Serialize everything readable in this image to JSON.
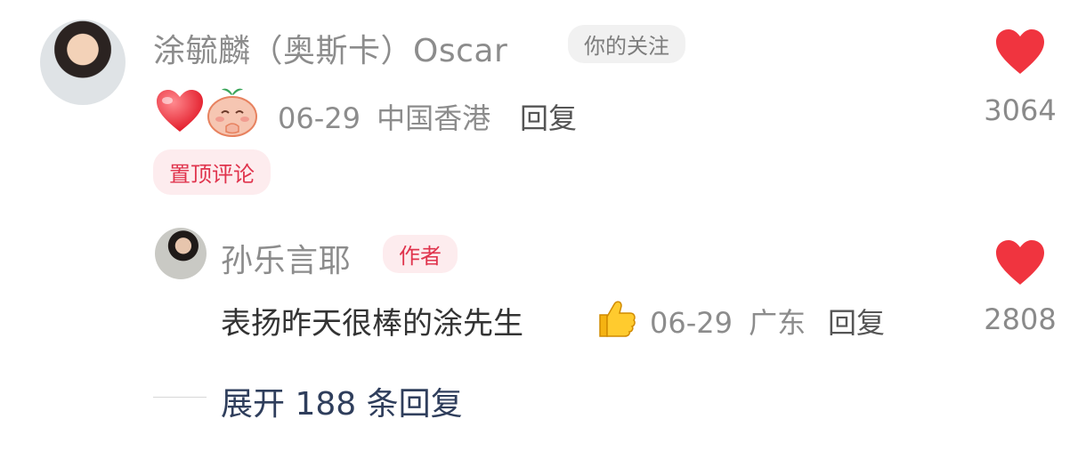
{
  "comment": {
    "username": "涂毓麟（奥斯卡）Oscar",
    "follow_tag": "你的关注",
    "emoji_1": "heart-emoji",
    "emoji_2": "peach-emoji",
    "date": "06-29",
    "location": "中国香港",
    "reply_label": "回复",
    "pinned_label": "置顶评论",
    "like_count": "3064",
    "like_color": "#f0343f"
  },
  "reply": {
    "username": "孙乐言耶",
    "author_tag": "作者",
    "text": "表扬昨天很棒的涂先生",
    "emoji": "thumbs-up-emoji",
    "date": "06-29",
    "location": "广东",
    "reply_label": "回复",
    "like_count": "2808"
  },
  "expand": {
    "label": "展开 188 条回复"
  }
}
